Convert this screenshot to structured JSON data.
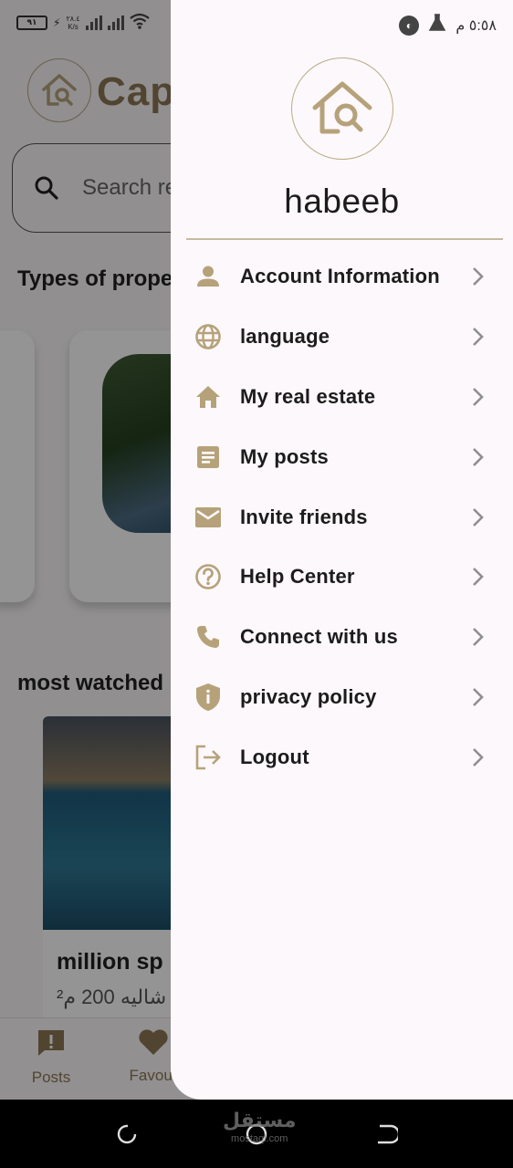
{
  "status_bar": {
    "battery": "٩١",
    "net_speed_value": "٢٨.٤",
    "net_speed_unit": "K/s",
    "time": "٥:٥٨ م"
  },
  "background": {
    "brand": "Capi",
    "search_placeholder": "Search re",
    "types_title": "Types of prope",
    "most_watched_title": "most watched",
    "card_title": "million sp",
    "card_subtitle": "شاليه 200 م²",
    "nav": [
      {
        "label": "Posts",
        "icon": "alert-icon"
      },
      {
        "label": "Favour",
        "icon": "heart-icon"
      }
    ]
  },
  "drawer": {
    "username": "habeeb",
    "menu": [
      {
        "label": "Account Information",
        "icon": "person-icon"
      },
      {
        "label": "language",
        "icon": "globe-icon"
      },
      {
        "label": "My real estate",
        "icon": "home-icon"
      },
      {
        "label": "My posts",
        "icon": "document-icon"
      },
      {
        "label": "Invite friends",
        "icon": "mail-icon"
      },
      {
        "label": "Help Center",
        "icon": "help-icon"
      },
      {
        "label": "Connect with us",
        "icon": "phone-icon"
      },
      {
        "label": "privacy policy",
        "icon": "shield-icon"
      },
      {
        "label": "Logout",
        "icon": "logout-icon"
      }
    ]
  },
  "watermark": {
    "name": "مستقل",
    "domain": "mostaql.com"
  },
  "colors": {
    "accent": "#b6a27a",
    "text": "#1c1c1c",
    "drawer_bg": "#fdf8fb"
  }
}
